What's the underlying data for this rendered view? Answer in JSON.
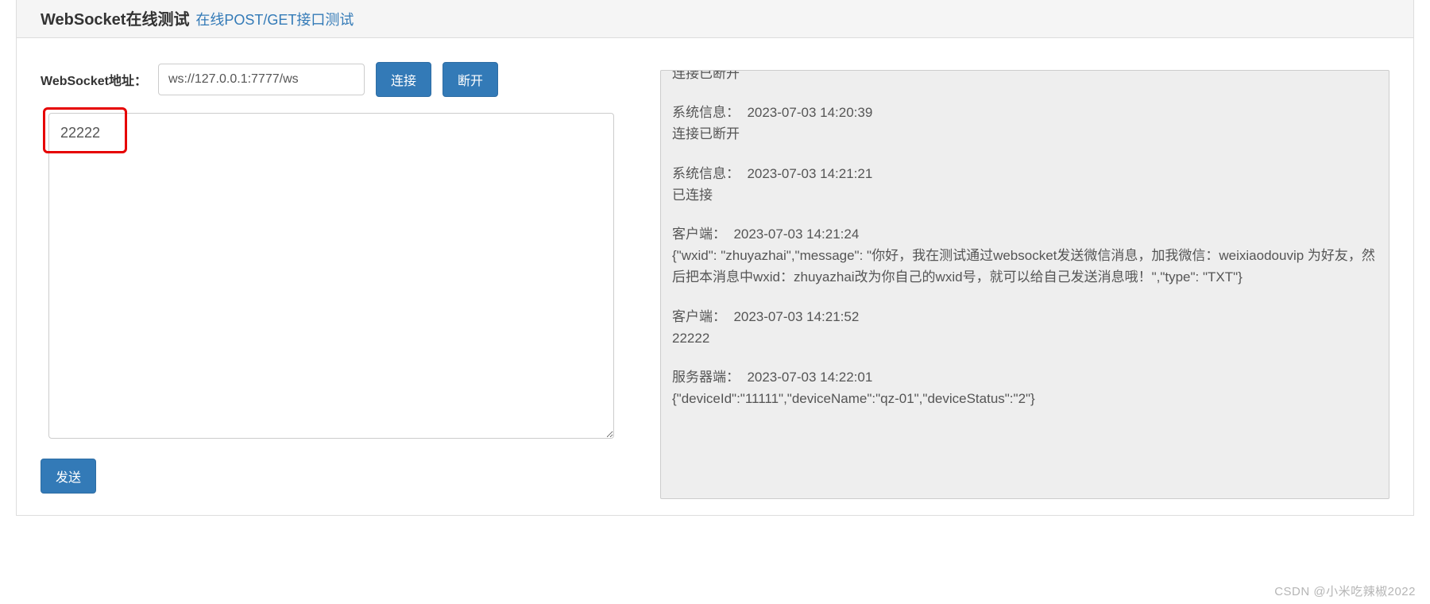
{
  "header": {
    "title": "WebSocket在线测试",
    "link": "在线POST/GET接口测试"
  },
  "ws": {
    "label": "WebSocket地址：",
    "url": "ws://127.0.0.1:7777/ws",
    "connect_label": "连接",
    "disconnect_label": "断开"
  },
  "message": {
    "value": "22222"
  },
  "send": {
    "label": "发送"
  },
  "log": {
    "entries": [
      {
        "header": "",
        "body": "连接已断开",
        "cut": true
      },
      {
        "header": "系统信息：  2023-07-03 14:20:39",
        "body": "连接已断开"
      },
      {
        "header": "系统信息：  2023-07-03 14:21:21",
        "body": "已连接"
      },
      {
        "header": "客户端：  2023-07-03 14:21:24",
        "body": "{\"wxid\": \"zhuyazhai\",\"message\": \"你好，我在测试通过websocket发送微信消息，加我微信：weixiaodouvip 为好友，然后把本消息中wxid：zhuyazhai改为你自己的wxid号，就可以给自己发送消息哦！\",\"type\": \"TXT\"}"
      },
      {
        "header": "客户端：  2023-07-03 14:21:52",
        "body": "22222"
      },
      {
        "header": "服务器端：  2023-07-03 14:22:01",
        "body": "{\"deviceId\":\"11111\",\"deviceName\":\"qz-01\",\"deviceStatus\":\"2\"}"
      }
    ]
  },
  "watermark": "CSDN @小米吃辣椒2022"
}
